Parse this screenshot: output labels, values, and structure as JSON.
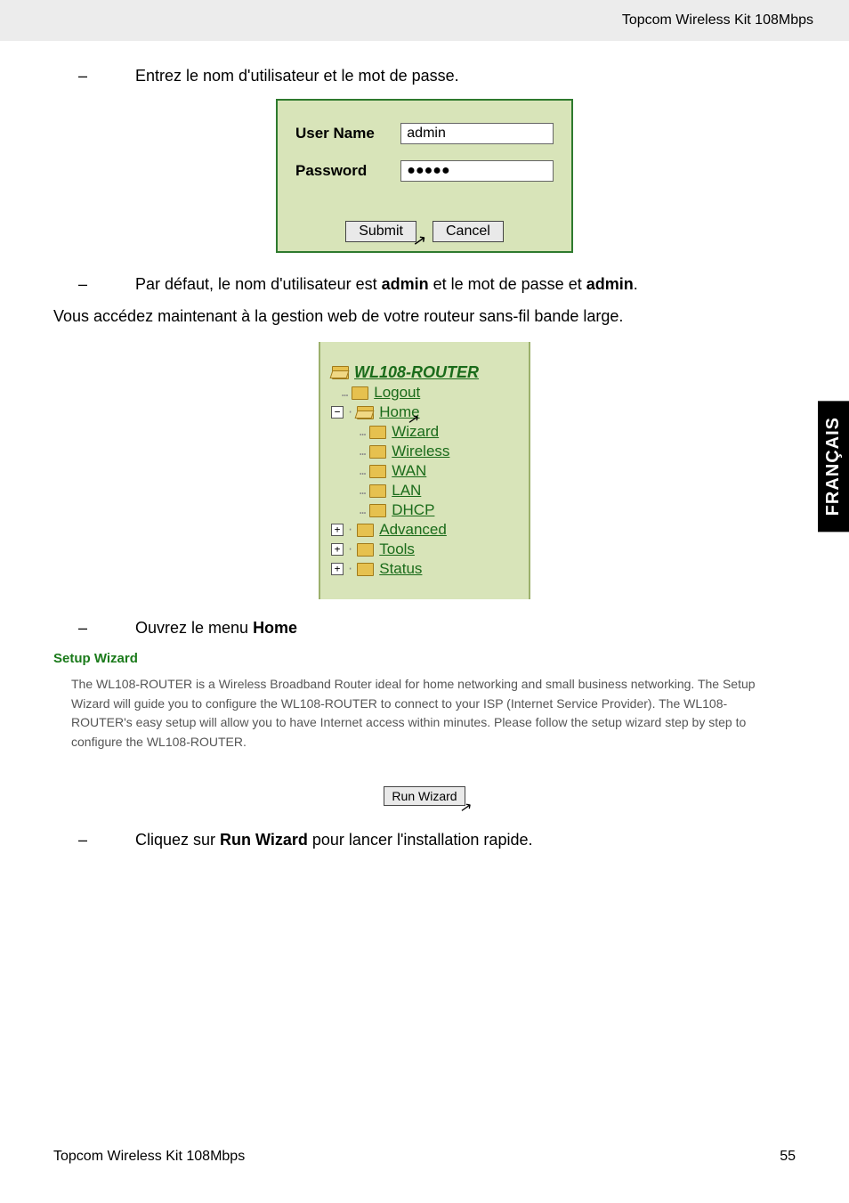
{
  "header_right": "Topcom Wireless Kit 108Mbps",
  "side_tab": "FRANÇAIS",
  "dash": "–",
  "line1": "Entrez le nom d'utilisateur et le mot de passe.",
  "login": {
    "user_label": "User Name",
    "user_value": "admin",
    "pass_label": "Password",
    "pass_value": "●●●●●",
    "submit": "Submit",
    "cancel": "Cancel"
  },
  "line2_pre": "Par défaut, le nom d'utilisateur est ",
  "line2_b1": "admin",
  "line2_mid": " et le mot de passe et ",
  "line2_b2": "admin",
  "line2_post": ".",
  "para1": "Vous accédez maintenant à la gestion web de votre routeur sans-fil bande large.",
  "menu": {
    "root": "WL108-ROUTER",
    "logout": "Logout",
    "home": "Home",
    "wizard": "Wizard",
    "wireless": "Wireless",
    "wan": "WAN",
    "lan": "LAN",
    "dhcp": "DHCP",
    "advanced": "Advanced",
    "tools": "Tools",
    "status": "Status"
  },
  "line3_pre": "Ouvrez le menu ",
  "line3_b": "Home",
  "swz_title": "Setup Wizard",
  "swz_text": "The WL108-ROUTER is a Wireless Broadband Router ideal for home networking and small business networking. The Setup Wizard will guide you to configure the WL108-ROUTER to connect to your ISP (Internet Service Provider). The WL108-ROUTER's easy setup will allow you to have Internet access within minutes. Please follow the setup wizard step by step to configure the WL108-ROUTER.",
  "run_label": "Run Wizard",
  "line4_pre": "Cliquez sur ",
  "line4_b": "Run Wizard",
  "line4_post": " pour lancer l'installation rapide.",
  "footer_left": "Topcom Wireless Kit 108Mbps",
  "footer_right": "55",
  "cursor_glyph": "↖"
}
